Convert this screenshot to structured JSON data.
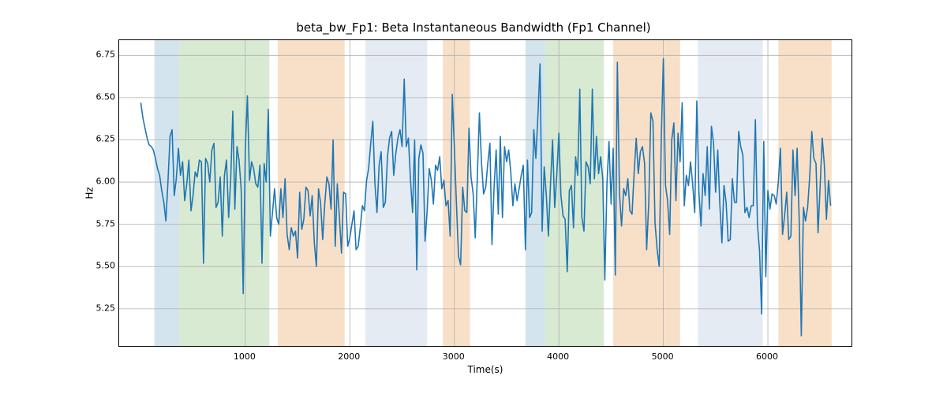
{
  "chart_data": {
    "type": "line",
    "title": "beta_bw_Fp1: Beta Instantaneous Bandwidth (Fp1 Channel)",
    "xlabel": "Time(s)",
    "ylabel": "Hz",
    "xlim": [
      -207,
      6800
    ],
    "ylim": [
      5.03,
      6.84
    ],
    "xticks": [
      1000,
      2000,
      3000,
      4000,
      5000,
      6000
    ],
    "yticks": [
      5.25,
      5.5,
      5.75,
      6.0,
      6.25,
      6.5,
      6.75
    ],
    "ytick_labels": [
      "5.25",
      "5.50",
      "5.75",
      "6.00",
      "6.25",
      "6.50",
      "6.75"
    ],
    "bands": [
      {
        "x0": 130,
        "x1": 370,
        "color": "#d4e4ee"
      },
      {
        "x0": 370,
        "x1": 1230,
        "color": "#d9ead3"
      },
      {
        "x0": 1310,
        "x1": 1950,
        "color": "#f8e0c8"
      },
      {
        "x0": 2150,
        "x1": 2740,
        "color": "#e4ebf3"
      },
      {
        "x0": 2890,
        "x1": 3150,
        "color": "#f8e0c8"
      },
      {
        "x0": 3680,
        "x1": 3870,
        "color": "#d4e4ee"
      },
      {
        "x0": 3870,
        "x1": 4430,
        "color": "#d9ead3"
      },
      {
        "x0": 4520,
        "x1": 5160,
        "color": "#f8e0c8"
      },
      {
        "x0": 5330,
        "x1": 5950,
        "color": "#e4ebf3"
      },
      {
        "x0": 6100,
        "x1": 6610,
        "color": "#f8e0c8"
      }
    ],
    "x": [
      0,
      20,
      40,
      60,
      80,
      100,
      120,
      140,
      160,
      180,
      200,
      220,
      240,
      260,
      280,
      300,
      320,
      340,
      360,
      380,
      400,
      420,
      440,
      460,
      480,
      500,
      520,
      540,
      560,
      580,
      600,
      620,
      640,
      660,
      680,
      700,
      720,
      740,
      760,
      780,
      800,
      820,
      840,
      860,
      880,
      900,
      920,
      940,
      960,
      980,
      1000,
      1020,
      1040,
      1060,
      1080,
      1100,
      1120,
      1140,
      1160,
      1180,
      1200,
      1220,
      1240,
      1260,
      1280,
      1300,
      1320,
      1340,
      1360,
      1380,
      1400,
      1420,
      1440,
      1460,
      1480,
      1500,
      1520,
      1540,
      1560,
      1580,
      1600,
      1620,
      1640,
      1660,
      1680,
      1700,
      1720,
      1740,
      1760,
      1780,
      1800,
      1820,
      1840,
      1860,
      1880,
      1900,
      1920,
      1940,
      1960,
      1980,
      2000,
      2020,
      2040,
      2060,
      2080,
      2100,
      2120,
      2140,
      2160,
      2180,
      2200,
      2220,
      2240,
      2260,
      2280,
      2300,
      2320,
      2340,
      2360,
      2380,
      2400,
      2420,
      2440,
      2460,
      2480,
      2500,
      2520,
      2540,
      2560,
      2580,
      2600,
      2620,
      2640,
      2660,
      2680,
      2700,
      2720,
      2740,
      2760,
      2780,
      2800,
      2820,
      2840,
      2860,
      2880,
      2900,
      2920,
      2940,
      2960,
      2980,
      3000,
      3020,
      3040,
      3060,
      3080,
      3100,
      3120,
      3140,
      3160,
      3180,
      3200,
      3220,
      3240,
      3260,
      3280,
      3300,
      3320,
      3340,
      3360,
      3380,
      3400,
      3420,
      3440,
      3460,
      3480,
      3500,
      3520,
      3540,
      3560,
      3580,
      3600,
      3620,
      3640,
      3660,
      3680,
      3700,
      3720,
      3740,
      3760,
      3780,
      3800,
      3820,
      3840,
      3860,
      3880,
      3900,
      3920,
      3940,
      3960,
      3980,
      4000,
      4020,
      4040,
      4060,
      4080,
      4100,
      4120,
      4140,
      4160,
      4180,
      4200,
      4220,
      4240,
      4260,
      4280,
      4300,
      4320,
      4340,
      4360,
      4380,
      4400,
      4420,
      4440,
      4460,
      4480,
      4500,
      4520,
      4540,
      4560,
      4580,
      4600,
      4620,
      4640,
      4660,
      4680,
      4700,
      4720,
      4740,
      4760,
      4780,
      4800,
      4820,
      4840,
      4860,
      4880,
      4900,
      4920,
      4940,
      4960,
      4980,
      5000,
      5020,
      5040,
      5060,
      5080,
      5100,
      5120,
      5140,
      5160,
      5180,
      5200,
      5220,
      5240,
      5260,
      5280,
      5300,
      5320,
      5340,
      5360,
      5380,
      5400,
      5420,
      5440,
      5460,
      5480,
      5500,
      5520,
      5540,
      5560,
      5580,
      5600,
      5620,
      5640,
      5660,
      5680,
      5700,
      5720,
      5740,
      5760,
      5780,
      5800,
      5820,
      5840,
      5860,
      5880,
      5900,
      5920,
      5940,
      5960,
      5980,
      6000,
      6020,
      6040,
      6060,
      6080,
      6100,
      6120,
      6140,
      6160,
      6180,
      6200,
      6220,
      6240,
      6260,
      6280,
      6300,
      6320,
      6340,
      6360,
      6380,
      6400,
      6420,
      6440,
      6460,
      6480,
      6500,
      6520,
      6540,
      6560,
      6580,
      6600
    ],
    "values": [
      6.47,
      6.38,
      6.32,
      6.26,
      6.22,
      6.21,
      6.19,
      6.14,
      6.08,
      6.04,
      5.95,
      5.88,
      5.77,
      6.0,
      6.27,
      6.31,
      5.92,
      6.02,
      6.2,
      6.04,
      6.12,
      5.89,
      5.99,
      6.13,
      5.83,
      5.92,
      6.06,
      6.03,
      6.13,
      6.12,
      5.52,
      6.14,
      6.11,
      6.0,
      6.19,
      6.23,
      5.85,
      5.88,
      6.03,
      5.68,
      6.04,
      6.13,
      5.79,
      6.01,
      6.42,
      5.84,
      6.21,
      6.13,
      5.96,
      5.34,
      6.2,
      6.51,
      6.01,
      6.12,
      6.08,
      5.99,
      5.97,
      6.1,
      5.52,
      6.11,
      6.0,
      6.43,
      5.68,
      5.82,
      5.96,
      5.79,
      5.75,
      5.96,
      5.79,
      6.02,
      5.69,
      5.6,
      5.73,
      5.68,
      5.71,
      5.55,
      5.94,
      5.72,
      5.78,
      5.97,
      5.95,
      5.8,
      5.92,
      5.64,
      5.5,
      5.96,
      5.88,
      5.66,
      5.87,
      6.03,
      5.99,
      5.84,
      6.25,
      5.62,
      5.99,
      5.8,
      5.58,
      5.94,
      5.93,
      5.62,
      5.67,
      5.75,
      5.83,
      5.6,
      5.62,
      5.73,
      5.86,
      5.83,
      6.01,
      6.08,
      6.23,
      6.36,
      5.99,
      5.82,
      6.1,
      6.18,
      5.85,
      5.88,
      6.15,
      6.26,
      6.3,
      6.04,
      6.17,
      6.26,
      6.31,
      6.21,
      6.61,
      6.21,
      6.26,
      6.02,
      5.82,
      6.25,
      5.48,
      6.14,
      6.22,
      6.17,
      5.65,
      5.83,
      6.08,
      6.01,
      5.87,
      6.1,
      6.07,
      6.15,
      5.96,
      6.01,
      5.86,
      5.89,
      5.68,
      6.52,
      6.21,
      5.87,
      5.56,
      5.51,
      5.97,
      5.83,
      5.82,
      6.32,
      6.03,
      5.93,
      5.67,
      6.04,
      6.41,
      6.11,
      5.93,
      5.97,
      6.11,
      6.23,
      5.63,
      5.97,
      6.19,
      5.81,
      6.27,
      5.79,
      6.21,
      6.12,
      6.19,
      6.06,
      5.86,
      5.99,
      5.89,
      5.96,
      6.04,
      6.1,
      5.6,
      6.13,
      5.79,
      5.82,
      6.31,
      6.14,
      6.4,
      6.7,
      5.71,
      6.09,
      5.92,
      5.68,
      5.99,
      6.25,
      5.85,
      6.04,
      6.29,
      5.92,
      5.8,
      5.78,
      5.47,
      5.95,
      5.98,
      5.73,
      6.15,
      6.04,
      6.55,
      5.79,
      5.71,
      6.12,
      6.09,
      5.99,
      6.55,
      6.02,
      6.27,
      6.05,
      6.15,
      6.02,
      5.42,
      5.99,
      6.24,
      5.87,
      6.2,
      5.45,
      6.71,
      5.93,
      5.74,
      5.96,
      5.92,
      6.02,
      5.83,
      5.81,
      6.05,
      6.26,
      6.05,
      6.18,
      6.21,
      6.11,
      5.6,
      5.88,
      6.41,
      6.36,
      5.76,
      5.6,
      5.5,
      6.27,
      6.73,
      5.98,
      5.89,
      5.69,
      6.25,
      6.35,
      5.89,
      6.29,
      6.12,
      6.47,
      5.86,
      6.04,
      5.98,
      6.12,
      5.99,
      5.82,
      6.48,
      5.94,
      5.74,
      6.05,
      5.92,
      6.21,
      5.84,
      6.33,
      6.23,
      5.94,
      6.19,
      5.87,
      5.64,
      5.98,
      5.88,
      5.65,
      5.66,
      6.02,
      5.88,
      5.88,
      6.3,
      6.21,
      6.16,
      5.82,
      5.85,
      5.79,
      5.86,
      5.86,
      6.37,
      5.75,
      5.59,
      5.22,
      6.24,
      5.44,
      5.95,
      5.84,
      5.93,
      5.92,
      5.87,
      6.0,
      6.2,
      5.69,
      5.8,
      5.94,
      5.66,
      5.68,
      6.19,
      5.92,
      6.2,
      5.76,
      5.09,
      5.85,
      5.77,
      5.85,
      6.03,
      6.3,
      6.14,
      6.11,
      5.7,
      5.98,
      6.26,
      6.1,
      5.78,
      6.01,
      5.86,
      5.96
    ]
  }
}
